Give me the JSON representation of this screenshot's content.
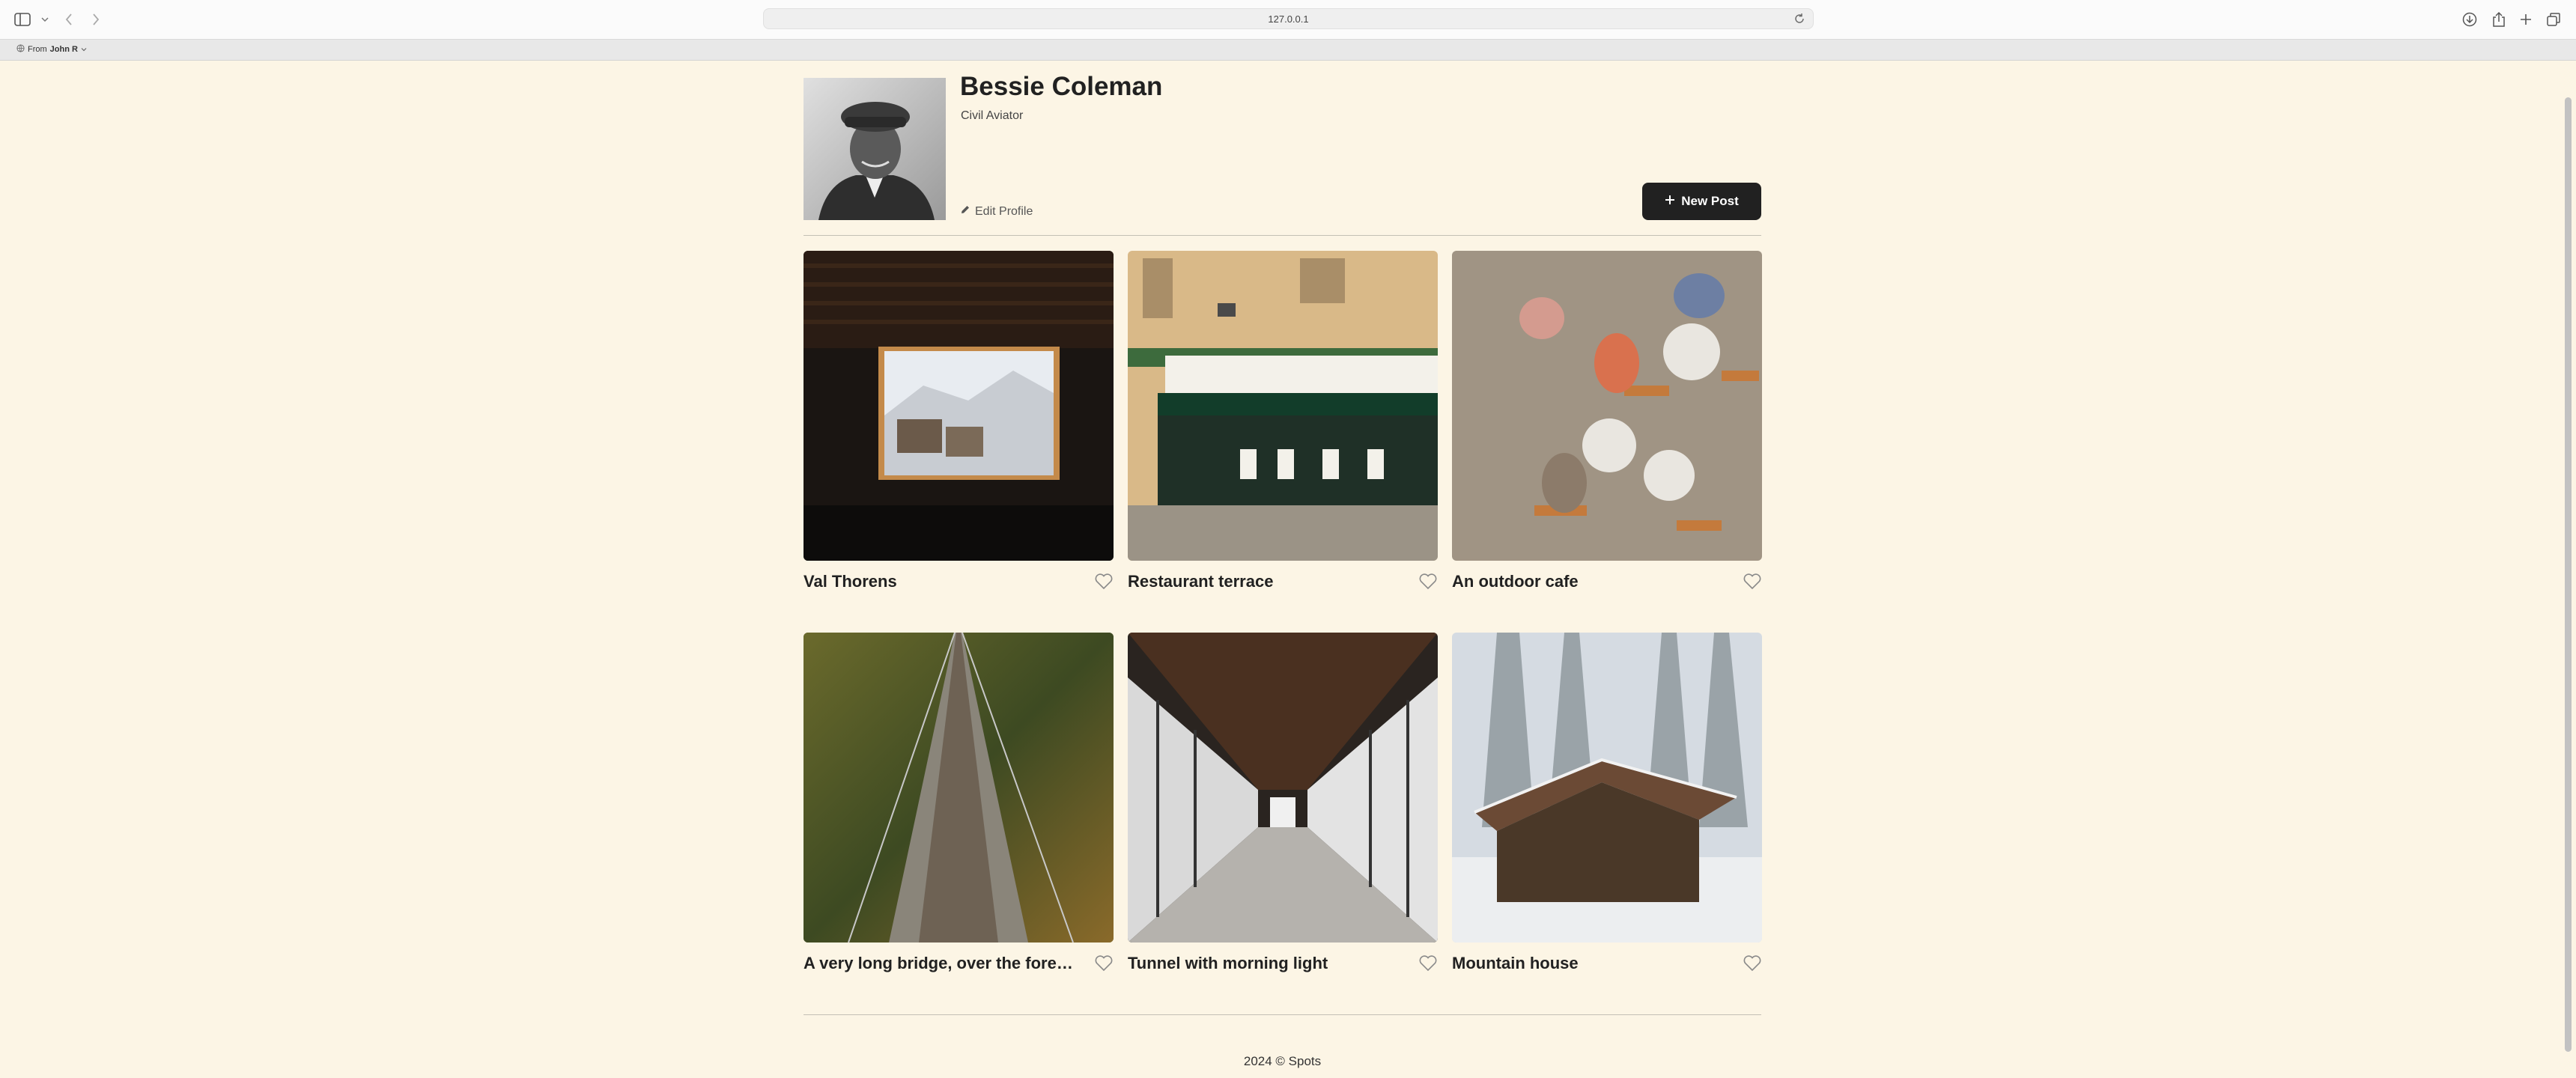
{
  "browser": {
    "url": "127.0.0.1",
    "bookmark_prefix": "From",
    "bookmark_name": "John R"
  },
  "profile": {
    "name": "Bessie Coleman",
    "job": "Civil Aviator",
    "edit_label": "Edit Profile",
    "new_post_label": "New Post"
  },
  "cards": [
    {
      "title": "Val Thorens",
      "icon": "heart-outline-icon"
    },
    {
      "title": "Restaurant terrace",
      "icon": "heart-outline-icon"
    },
    {
      "title": "An outdoor cafe",
      "icon": "heart-outline-icon"
    },
    {
      "title": "A very long bridge, over the forest...",
      "icon": "heart-outline-icon"
    },
    {
      "title": "Tunnel with morning light",
      "icon": "heart-outline-icon"
    },
    {
      "title": "Mountain house",
      "icon": "heart-outline-icon"
    }
  ],
  "footer": {
    "text": "2024 © Spots"
  },
  "colors": {
    "background": "#fcf5e5",
    "primary": "#212121"
  }
}
